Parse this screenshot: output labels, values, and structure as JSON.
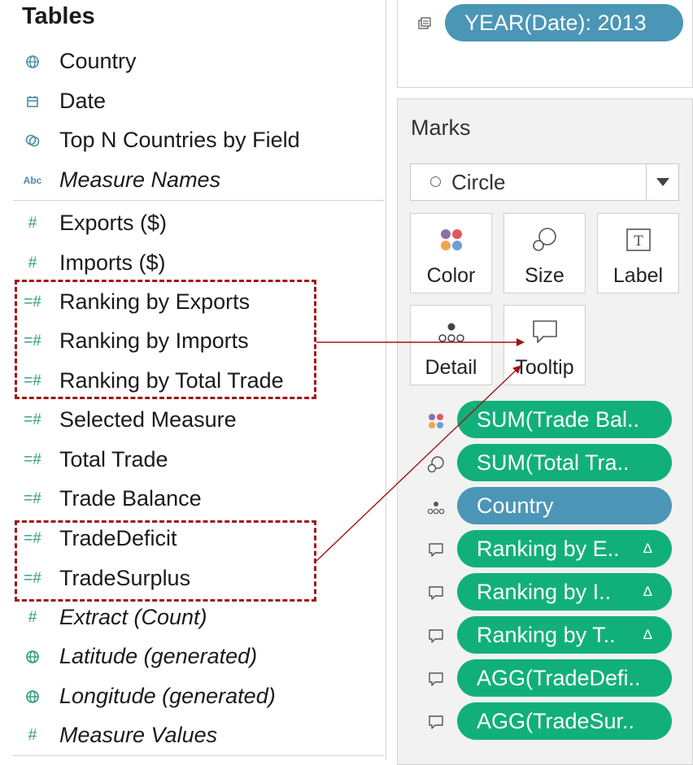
{
  "data_pane": {
    "title": "Tables",
    "dimensions": [
      {
        "label": "Country",
        "icon": "globe-icon"
      },
      {
        "label": "Date",
        "icon": "calendar-icon"
      },
      {
        "label": "Top N Countries by Field",
        "icon": "set-icon"
      },
      {
        "label": "Measure Names",
        "icon": "abc-icon",
        "icon_text": "Abc"
      }
    ],
    "measures": [
      {
        "label": "Exports ($)",
        "icon": "number-icon"
      },
      {
        "label": "Imports ($)",
        "icon": "number-icon"
      },
      {
        "label": "Ranking by Exports",
        "icon": "calculated-number-icon"
      },
      {
        "label": "Ranking by Imports",
        "icon": "calculated-number-icon"
      },
      {
        "label": "Ranking by Total Trade",
        "icon": "calculated-number-icon"
      },
      {
        "label": "Selected Measure",
        "icon": "calculated-number-icon"
      },
      {
        "label": "Total Trade",
        "icon": "calculated-number-icon"
      },
      {
        "label": "Trade Balance",
        "icon": "calculated-number-icon"
      },
      {
        "label": "TradeDeficit",
        "icon": "calculated-number-icon"
      },
      {
        "label": "TradeSurplus",
        "icon": "calculated-number-icon"
      },
      {
        "label": "Extract (Count)",
        "icon": "number-icon"
      },
      {
        "label": "Latitude (generated)",
        "icon": "globe-icon"
      },
      {
        "label": "Longitude (generated)",
        "icon": "globe-icon"
      },
      {
        "label": "Measure Values",
        "icon": "number-icon"
      }
    ]
  },
  "filters": {
    "pill": "YEAR(Date): 2013",
    "icon": "filter-shelf-icon"
  },
  "marks": {
    "title": "Marks",
    "mark_type": "Circle",
    "buttons": {
      "color": "Color",
      "size": "Size",
      "label": "Label",
      "detail": "Detail",
      "tooltip": "Tooltip"
    },
    "pills": [
      {
        "label": "SUM(Trade Bal..",
        "icon": "color-icon",
        "style": "green",
        "delta": ""
      },
      {
        "label": "SUM(Total Tra..",
        "icon": "size-icon",
        "style": "green",
        "delta": ""
      },
      {
        "label": "Country",
        "icon": "detail-icon",
        "style": "blue",
        "delta": ""
      },
      {
        "label": "Ranking by E..",
        "icon": "tooltip-icon",
        "style": "green",
        "delta": "Δ"
      },
      {
        "label": "Ranking by I..",
        "icon": "tooltip-icon",
        "style": "green",
        "delta": "Δ"
      },
      {
        "label": "Ranking by T..",
        "icon": "tooltip-icon",
        "style": "green",
        "delta": "Δ"
      },
      {
        "label": "AGG(TradeDefi..",
        "icon": "tooltip-icon",
        "style": "green",
        "delta": ""
      },
      {
        "label": "AGG(TradeSur..",
        "icon": "tooltip-icon",
        "style": "green",
        "delta": ""
      }
    ]
  },
  "colors": {
    "measure_green": "#11b07b",
    "dimension_blue": "#4b96b6",
    "highlight_red": "#a21313"
  }
}
